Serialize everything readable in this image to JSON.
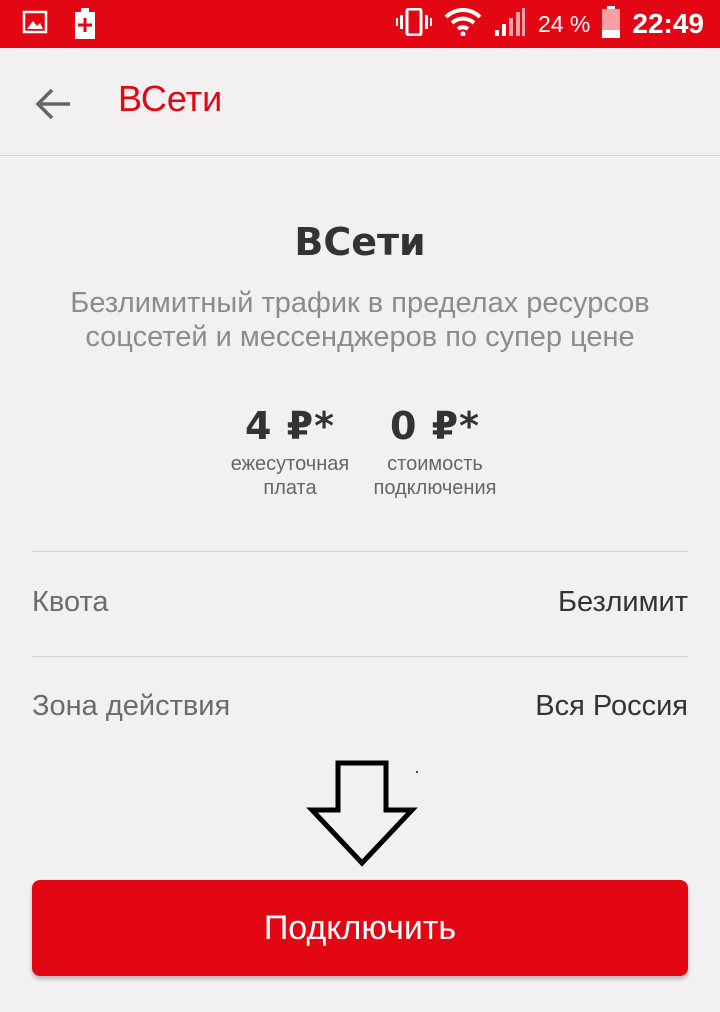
{
  "status_bar": {
    "battery_percent": "24 %",
    "time": "22:49",
    "icons": [
      "image-icon",
      "battery-saver-icon",
      "vibrate-icon",
      "wifi-icon",
      "signal-icon",
      "battery-icon"
    ],
    "background": "#e30613"
  },
  "app_bar": {
    "title": "ВСети",
    "back_icon": "arrow-left-icon",
    "title_color": "#e30613"
  },
  "offer": {
    "title": "ВСети",
    "description": "Безлимитный трафик в пределах ресурсов соцсетей и мессенджеров по супер цене"
  },
  "prices": [
    {
      "value": "4 ₽*",
      "label": "ежесуточная плата"
    },
    {
      "value": "0 ₽*",
      "label": "стоимость подключения"
    }
  ],
  "details": [
    {
      "key": "Квота",
      "value": "Безлимит"
    },
    {
      "key": "Зона действия",
      "value": "Вся Россия"
    }
  ],
  "connect_button": {
    "label": "Подключить",
    "color": "#e30613"
  }
}
